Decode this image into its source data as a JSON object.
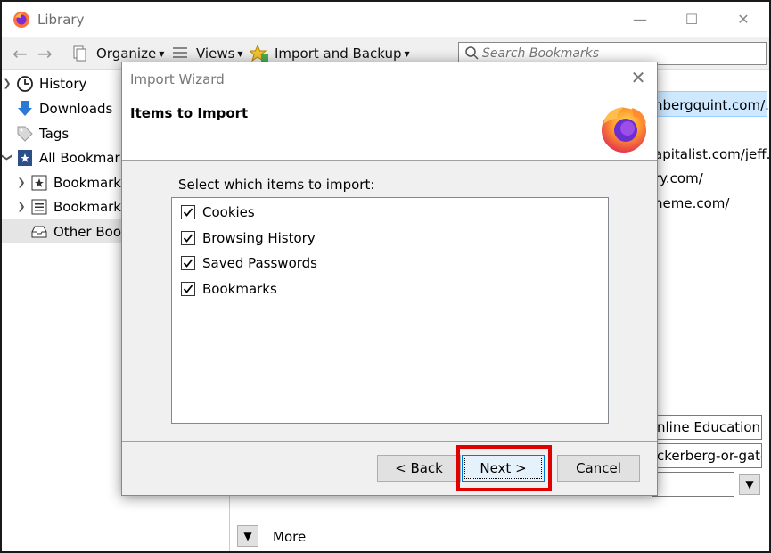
{
  "window": {
    "title": "Library"
  },
  "toolbar": {
    "organize": "Organize",
    "views": "Views",
    "import_backup": "Import and Backup",
    "search_placeholder": "Search Bookmarks"
  },
  "tree": {
    "items": [
      {
        "label": "History"
      },
      {
        "label": "Downloads"
      },
      {
        "label": "Tags"
      },
      {
        "label": "All Bookmarks"
      },
      {
        "label": "Bookmarks Toolbar"
      },
      {
        "label": "Bookmarks Menu"
      },
      {
        "label": "Other Bookmarks"
      }
    ]
  },
  "content": {
    "urls": [
      "nbergquint.com/...",
      "apitalist.com/jeff...",
      "ry.com/",
      "neme.com/"
    ],
    "field_name": "nline Education in",
    "field_location": "ckerberg-or-gate",
    "more": "More"
  },
  "dialog": {
    "title": "Import Wizard",
    "heading": "Items to Import",
    "prompt": "Select which items to import:",
    "items": [
      {
        "label": "Cookies",
        "checked": true
      },
      {
        "label": "Browsing History",
        "checked": true
      },
      {
        "label": "Saved Passwords",
        "checked": true
      },
      {
        "label": "Bookmarks",
        "checked": true
      }
    ],
    "back_label": "< Back",
    "next_label": "Next >",
    "cancel_label": "Cancel"
  },
  "colors": {
    "highlight": "#e00000",
    "selection": "#cde8ff"
  }
}
